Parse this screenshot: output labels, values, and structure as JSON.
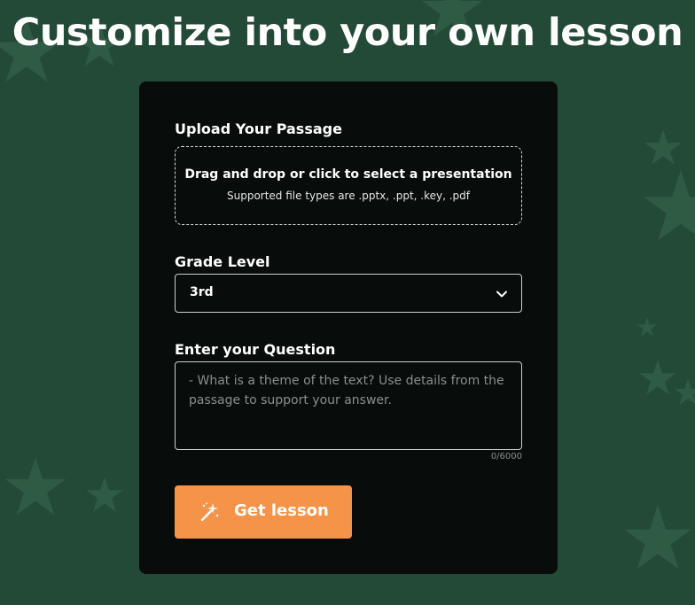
{
  "page": {
    "title": "Customize into your own lesson"
  },
  "upload": {
    "label": "Upload Your Passage",
    "drop_text": "Drag and drop or click to select a presentation",
    "supported_text": "Supported file types are .pptx, .ppt, .key, .pdf"
  },
  "grade": {
    "label": "Grade Level",
    "selected": "3rd",
    "icon": "chevron-down-icon"
  },
  "question": {
    "label": "Enter your Question",
    "value": "",
    "placeholder": "- What is a theme of the text? Use details from the passage to support your answer.",
    "counter": "0/6000"
  },
  "submit": {
    "label": "Get lesson",
    "icon": "magic-wand-icon"
  },
  "colors": {
    "background": "#234a37",
    "card": "#080c0b",
    "accent": "#f59448",
    "star": "#2f5a44"
  }
}
